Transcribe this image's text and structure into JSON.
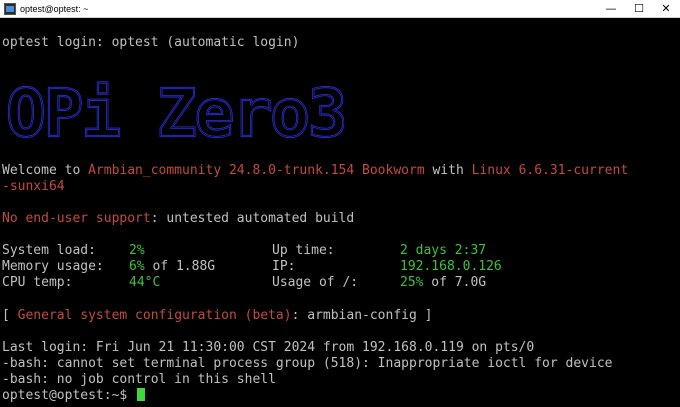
{
  "window": {
    "title": "optest@optest: ~",
    "controls": {
      "minimize": "—",
      "maximize": "☐",
      "close": "✕"
    }
  },
  "terminal": {
    "login_line": "optest login: optest (automatic login)",
    "banner_text": "OPi Zero3",
    "welcome": {
      "prefix": "Welcome to ",
      "distro": "Armbian_community 24.8.0-trunk.154 Bookworm",
      "middle": " with ",
      "kernel": "Linux 6.6.31-current",
      "kernel_cont": "-sunxi64"
    },
    "support": {
      "label": "No end-user support",
      "text": ": untested automated build"
    },
    "stats": {
      "system_load_label": "System load:",
      "system_load_value": "2%",
      "uptime_label": "Up time:",
      "uptime_value": "2 days 2:37",
      "memory_label": "Memory usage:",
      "memory_value": "6%",
      "memory_total": " of 1.88G",
      "ip_label": "IP:",
      "ip_value": "192.168.0.126",
      "cpu_label": "CPU temp:",
      "cpu_value": "44°C",
      "usage_label": "Usage of /:",
      "usage_value": "25%",
      "usage_total": " of 7.0G"
    },
    "config": {
      "open": "[ ",
      "label": "General system configuration (beta)",
      "text": ": armbian-config ]"
    },
    "last_login": "Last login: Fri Jun 21 11:30:00 CST 2024 from 192.168.0.119 on pts/0",
    "bash_error1": "-bash: cannot set terminal process group (518): Inappropriate ioctl for device",
    "bash_error2": "-bash: no job control in this shell",
    "prompt": "optest@optest:~$ "
  },
  "colors": {
    "background": "#000000",
    "text": "#c0c0c0",
    "red": "#c24a3f",
    "green": "#3ec23e",
    "banner": "#2a2fd6"
  }
}
